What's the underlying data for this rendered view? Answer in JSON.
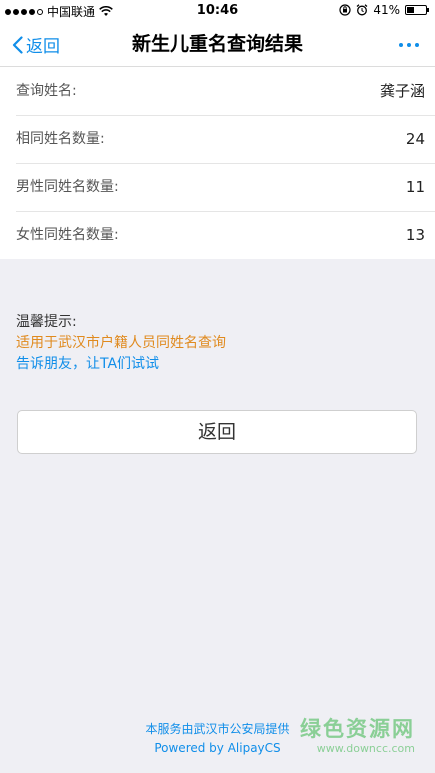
{
  "status_bar": {
    "carrier": "中国联通",
    "time": "10:46",
    "battery": "41%",
    "battery_level": 0.41
  },
  "nav": {
    "back_label": "返回",
    "title": "新生儿重名查询结果"
  },
  "results": [
    {
      "label": "查询姓名:",
      "value": "龚子涵"
    },
    {
      "label": "相同姓名数量:",
      "value": "24"
    },
    {
      "label": "男性同姓名数量:",
      "value": "11"
    },
    {
      "label": "女性同姓名数量:",
      "value": "13"
    }
  ],
  "tips": {
    "title": "温馨提示:",
    "line1": "适用于武汉市户籍人员同姓名查询",
    "line2": "告诉朋友，让TA们试试"
  },
  "return_button": "返回",
  "footer": {
    "line1": "本服务由武汉市公安局提供",
    "line2": "Powered by AlipayCS"
  },
  "watermark": {
    "main": "绿色资源网",
    "sub": "www.downcc.com"
  },
  "colors": {
    "accent": "#108ee9",
    "tip_orange": "#e08a1e",
    "watermark": "#39b54a"
  }
}
